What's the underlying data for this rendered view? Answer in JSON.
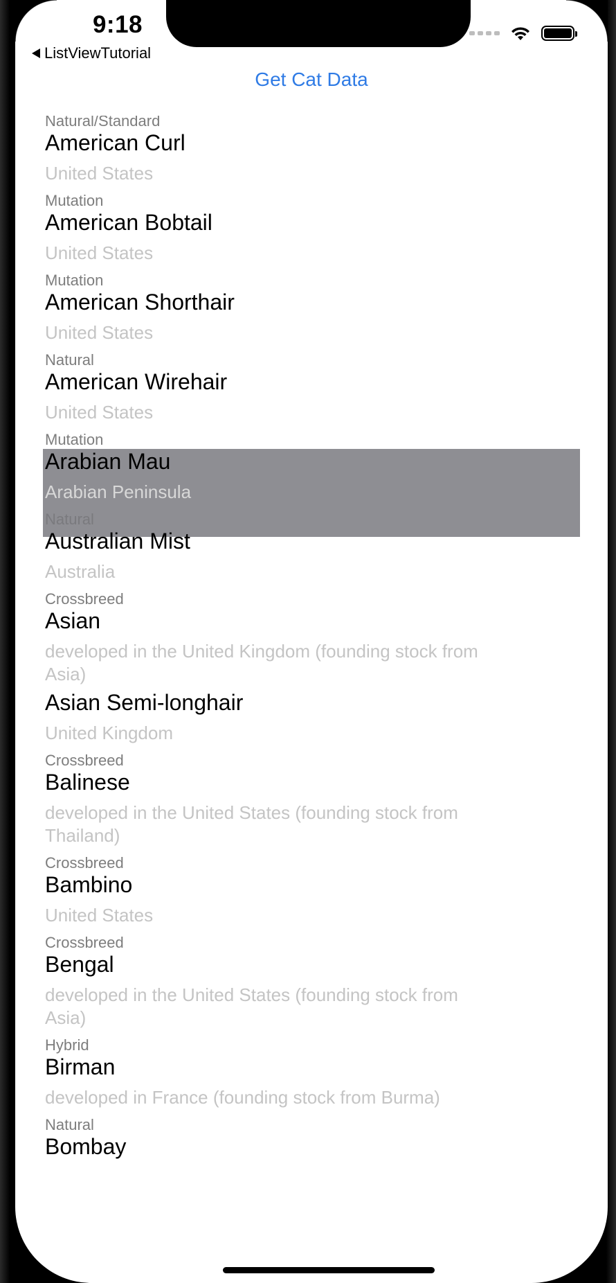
{
  "status_bar": {
    "time": "9:18",
    "back_label": "ListViewTutorial",
    "signal_icon": "signal-dots-icon",
    "wifi_icon": "wifi-icon",
    "battery_icon": "battery-icon"
  },
  "toolbar": {
    "get_data_label": "Get Cat Data"
  },
  "colors": {
    "accent": "#2f7be5",
    "selection": "#8e8e93",
    "origin_text": "#c4c4c4",
    "type_text": "#7d7d7d"
  },
  "list": {
    "top_partial_type": "Natural/Standard",
    "items": [
      {
        "name": "American Curl",
        "origin": "United States",
        "type": "Mutation"
      },
      {
        "name": "American Bobtail",
        "origin": "United States",
        "type": "Mutation"
      },
      {
        "name": "American Shorthair",
        "origin": "United States",
        "type": "Natural"
      },
      {
        "name": "American Wirehair",
        "origin": "United States",
        "type": "Mutation"
      },
      {
        "name": "Arabian Mau",
        "origin": "Arabian Peninsula",
        "type": "Natural"
      },
      {
        "name": "Australian Mist",
        "origin": "Australia",
        "type": "Crossbreed"
      },
      {
        "name": "Asian",
        "origin": "developed in the United Kingdom (founding stock from Asia)",
        "type": ""
      },
      {
        "name": "Asian Semi-longhair",
        "origin": "United Kingdom",
        "type": "Crossbreed"
      },
      {
        "name": "Balinese",
        "origin": "developed in the United States (founding stock from Thailand)",
        "type": "Crossbreed"
      },
      {
        "name": "Bambino",
        "origin": "United States",
        "type": "Crossbreed"
      },
      {
        "name": "Bengal",
        "origin": "developed in the United States (founding stock from Asia)",
        "type": "Hybrid"
      },
      {
        "name": "Birman",
        "origin": "developed in France (founding stock from Burma)",
        "type": "Natural"
      },
      {
        "name": "Bombay",
        "origin": "",
        "type": ""
      }
    ],
    "selected_index": 4
  }
}
